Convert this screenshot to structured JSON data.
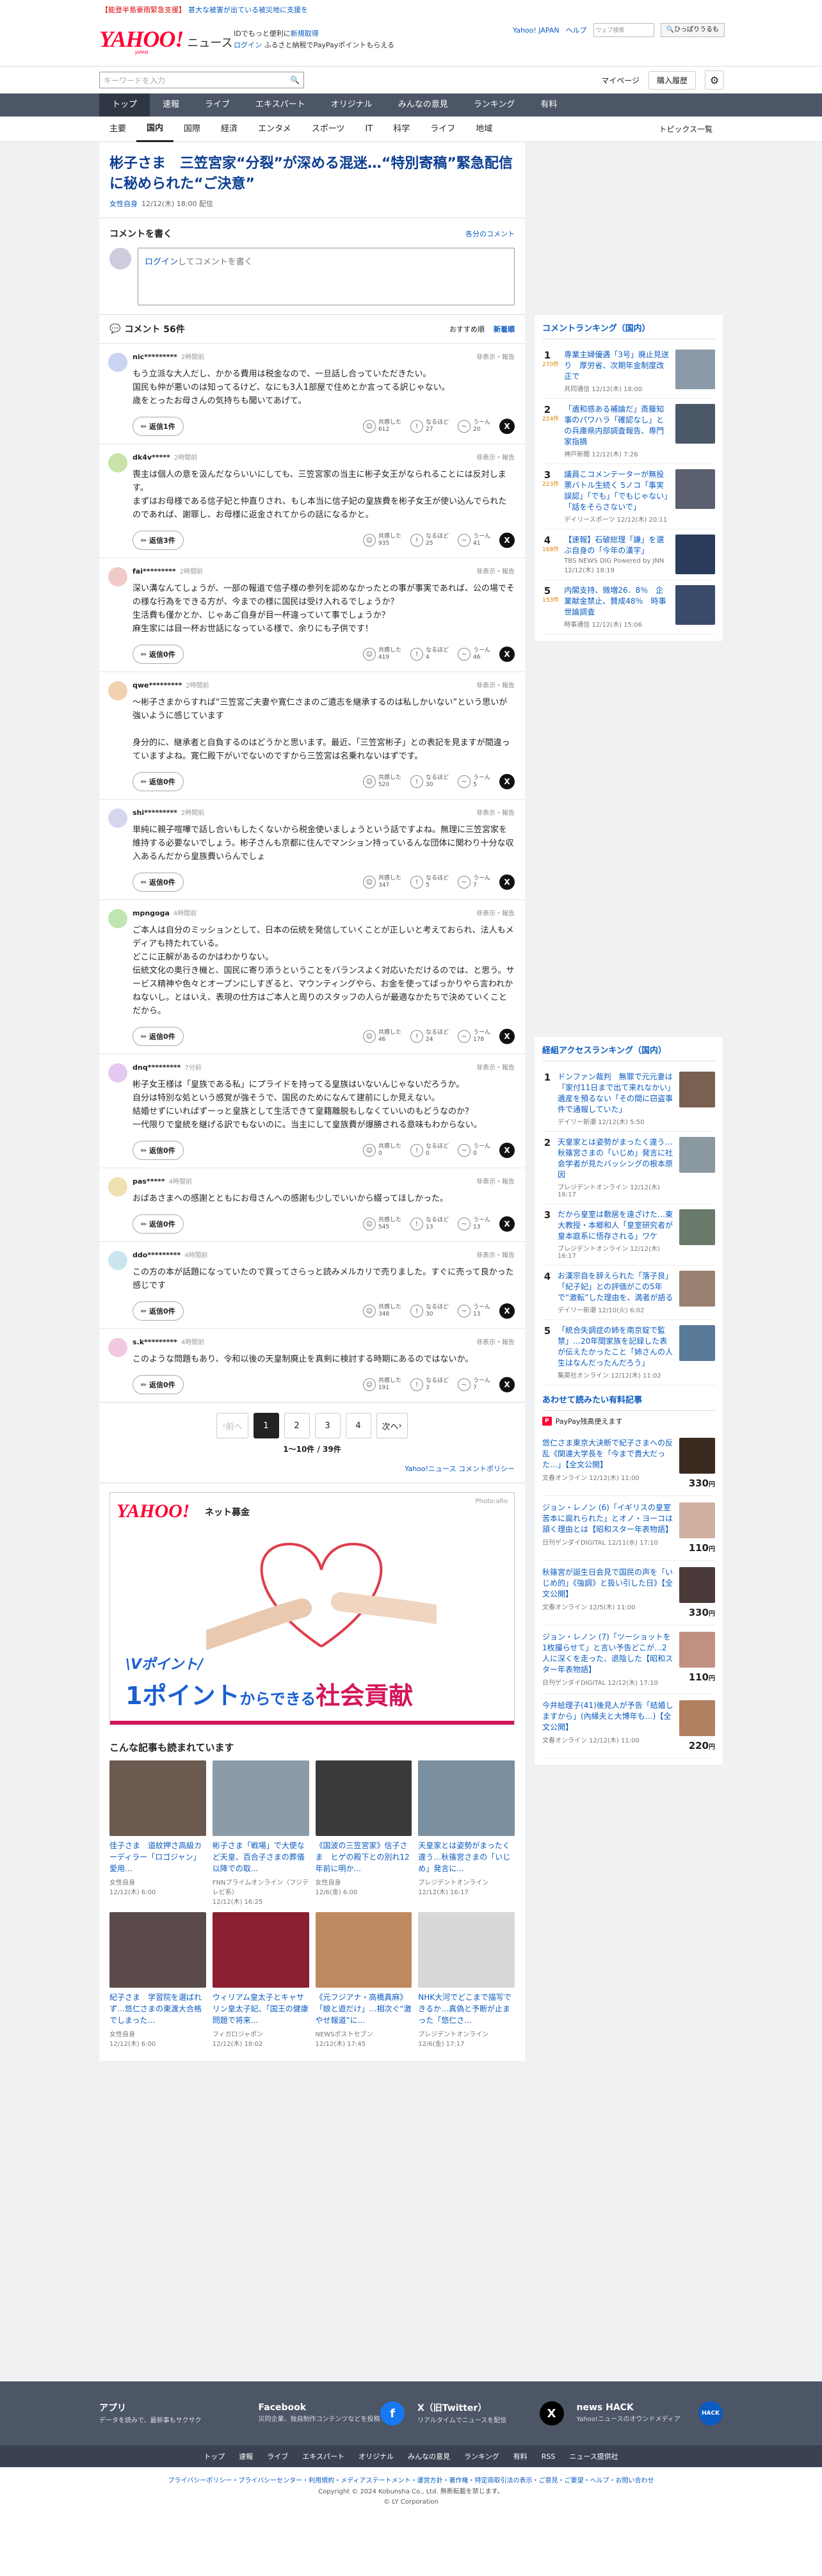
{
  "topad": {
    "tag": "【能登半島豪雨緊急支援】",
    "text": "甚大な被害が出ている被災地に支援を"
  },
  "header": {
    "logo": "YAHOO!",
    "logo_sub": "JAPAN",
    "service": "ニュース",
    "msg1": "IDでもっと便利に",
    "msg1_link": "新規取得",
    "msg2_link": "ログイン",
    "msg2_text": "ふるさと納税でPayPayポイントもらえる",
    "links": [
      "Yahoo! JAPAN",
      "ヘルプ"
    ],
    "site_search_placeholder": "ウェブ検索",
    "site_search_button": "🔍ひっぱりうるも"
  },
  "search": {
    "placeholder": "キーワードを入力",
    "my": "マイページ",
    "buy": "購入履歴"
  },
  "gnav": [
    "トップ",
    "速報",
    "ライブ",
    "エキスパート",
    "オリジナル",
    "みんなの意見",
    "ランキング",
    "有料"
  ],
  "snav": [
    "主要",
    "国内",
    "国際",
    "経済",
    "エンタメ",
    "スポーツ",
    "IT",
    "科学",
    "ライフ",
    "地域"
  ],
  "snav_right": "トピックス一覧",
  "article": {
    "title": "彬子さま　三笠宮家“分裂”が深める混迷…“特別寄稿”緊急配信に秘められた“ご決意”",
    "source": "女性自身",
    "date": "12/12(木) 18:00 配信"
  },
  "comment_form": {
    "title": "コメントを書く",
    "policy": "各分のコメント",
    "login": "ログイン",
    "placeholder": "してコメントを書く"
  },
  "comments_header": {
    "label": "コメント 56件",
    "sort1": "おすすめ順",
    "sort2": "新着順"
  },
  "comments": [
    {
      "user": "nic*********",
      "time": "2時間前",
      "report": "非表示・報告",
      "color": "#c9d4f0",
      "text": "もう立派な大人だし、かかる費用は税金なので、一旦話し合っていただきたい。\n国民も仲が悪いのは知ってるけど、なにも3人1部屋で住めとか言ってる訳じゃない。\n歳をとったお母さんの気持ちも聞いてあげて。",
      "reply": "返信1件",
      "k": "612",
      "n": "27",
      "u": "20"
    },
    {
      "user": "dk4v*****",
      "time": "2時間前",
      "report": "非表示・報告",
      "color": "#c9e3a8",
      "text": "喪主は個人の意を汲んだならいいにしても、三笠宮家の当主に彬子女王がなられることには反対します。\nまずはお母様である信子妃と仲直りされ、もし本当に信子妃の皇族費を彬子女王が使い込んでられたのであれば、謝罪し、お母様に返金されてからの話になるかと。",
      "reply": "返信3件",
      "k": "935",
      "n": "25",
      "u": "41"
    },
    {
      "user": "fai*********",
      "time": "2時間前",
      "report": "非表示・報告",
      "color": "#f0c9c9",
      "text": "深い溝なんてしょうが、一部の報道で信子様の参列を認めなかったとの事が事実であれば、公の場でその様な行為をできる方が、今までの様に国民は受け入れるでしょうか？\n生活費も僅かとか、じゃあご自身が目一杯違っていて事でしょうか？\n麻生家には目一杯お世話になっている様で、余りにも子供です！",
      "reply": "返信0件",
      "k": "419",
      "n": "4",
      "u": "46"
    },
    {
      "user": "qwe*********",
      "time": "2時間前",
      "report": "非表示・報告",
      "color": "#f0d2b0",
      "text": "〜彬子さまからすれば“三笠宮ご夫妻や寛仁さまのご遺志を継承するのは私しかいない”という思いが強いように感じています\n\n身分的に、継承者と自負するのはどうかと思います。最近、「三笠宮彬子」との表記を見ますが間違っていますよね。寛仁殿下がいでないのですから三笠宮は名乗れないはずです。",
      "reply": "返信0件",
      "k": "520",
      "n": "30",
      "u": "5"
    },
    {
      "user": "shi*********",
      "time": "2時間前",
      "report": "非表示・報告",
      "color": "#d6d6ee",
      "text": "単純に親子喧嘩で話し合いもしたくないから税金使いましょうという話ですよね。無理に三笠宮家を維持する必要ないでしょう。彬子さんも京都に住んでマンション持っているんな団体に関わり十分な収入あるんだから皇族費いらんでしょ",
      "reply": "返信0件",
      "k": "347",
      "n": "5",
      "u": "7"
    },
    {
      "user": "mpngoga",
      "time": "4時間前",
      "report": "非表示・報告",
      "color": "#bfe6b0",
      "text": "ご本人は自分のミッションとして、日本の伝統を発信していくことが正しいと考えておられ、法人もメディアも持たれている。\nどこに正解があるのかはわかりない。\n伝統文化の奥行き機と、国民に寄り添うということをバランスよく対応いただけるのでは、と思う。サービス精神や色々とオープンにしすぎると、マウンティングやら、お金を使ってばっかりやら言われかねないし。とはいえ、表現の仕方はご本人と周りのスタッフの人らが最適なかたちで決めていくことだから。",
      "reply": "返信0件",
      "k": "46",
      "n": "24",
      "u": "178"
    },
    {
      "user": "dnq*********",
      "time": "7分前",
      "report": "非表示・報告",
      "color": "#e6c9f0",
      "text": "彬子女王様は「皇族である私」にプライドを持ってる皇族はいないんじゃないだろうか。\n自分は特別な処という感覚が強そうで、国民のためになんて建前にしか見えない。\n結婚せずにいればずーっと皇族として生活できて皇籍離脱もしなくていいのもどうなのか？\n一代限りで皇統を継げる訳でもないのに。当主にして皇族費が爆勝される意味もわからない。",
      "reply": "返信0件",
      "k": "0",
      "n": "0",
      "u": "0"
    },
    {
      "user": "pas*****",
      "time": "4時間前",
      "report": "非表示・報告",
      "color": "#f0e0b0",
      "text": "おばあさまへの感謝とともにお母さんへの感謝も少しでいいから綴ってほしかった。",
      "reply": "返信0件",
      "k": "545",
      "n": "13",
      "u": "13"
    },
    {
      "user": "ddo*********",
      "time": "4時間前",
      "report": "非表示・報告",
      "color": "#c9e6f0",
      "text": "この方の本が話題になっていたので買ってさらっと読みメルカリで売りました。すぐに売って良かった感じです",
      "reply": "返信0件",
      "k": "348",
      "n": "30",
      "u": "13"
    },
    {
      "user": "s.k*********",
      "time": "4時間前",
      "report": "非表示・報告",
      "color": "#f0c9e0",
      "text": "このような問題もあり、令和以後の天皇制廃止を真剣に検討する時期にあるのではないか。",
      "reply": "返信0件",
      "k": "191",
      "n": "3",
      "u": "7"
    }
  ],
  "reaction_labels": {
    "k": "共感した",
    "n": "なるほど",
    "u": "うーん"
  },
  "pager": {
    "prev": "前へ",
    "pages": [
      "1",
      "2",
      "3",
      "4"
    ],
    "next": "次へ",
    "info": "1〜10件 / 39件",
    "policy": "Yahoo!ニュース コメントポリシー"
  },
  "ad": {
    "logo": "YAHOO!",
    "title": "ネット募金",
    "photo": "Photo:afio",
    "v": "\\Vポイント/",
    "big1": "1ポイント",
    "big2": "からできる",
    "big3": "社会貢献"
  },
  "related": {
    "title": "こんな記事も読まれています",
    "items": [
      {
        "t": "佳子さま　道紋押さ高級カーディラー「ロゴジャン」愛用...",
        "s": "女性自身\n12/12(木) 6:00",
        "c": "#6b5a50"
      },
      {
        "t": "彬子さま「戦場」で大使など天皇、百合子さまの葬儀以降での取...",
        "s": "FNNプライムオンライン（フジテレビ系）\n12/12(木) 16:25",
        "c": "#8c9ba8"
      },
      {
        "t": "《国波の三笠宮家》信子さま　ヒゲの殿下との別れ12年前に明か...",
        "s": "女性自身\n12/6(金) 6:00",
        "c": "#3a3a3a"
      },
      {
        "t": "天皇家とは姿勢がまったく違う…秋篠宮さまの「いじめ」発言に...",
        "s": "プレジデントオンライン\n12/12(木) 16:17",
        "c": "#7a8fa0"
      },
      {
        "t": "紀子さま　学習院を選ばれず…悠仁さまの東渡大合格でしまった...",
        "s": "女性自身\n12/12(木) 6:00",
        "c": "#5a4a4a"
      },
      {
        "t": "ウィリアム皇太子とキャサリン皇太子妃、「国王の健康問題で将来...",
        "s": "フィガロジャポン\n12/12(木) 18:02",
        "c": "#8a2030"
      },
      {
        "t": "《元フジアナ・高橋真麻》「娘と遊だけ」…相次ぐ“激やせ報道”に...",
        "s": "NEWSポストセブン\n12/12(木) 17:45",
        "c": "#c08a60"
      },
      {
        "t": "NHK大河でどこまで描写できるか…真偽と予断が止まった「悠仁さ...",
        "s": "プレジデントオンライン\n12/6(金) 17:17",
        "c": "#d8d8d8"
      }
    ]
  },
  "ranking": {
    "title": "コメントランキング（国内）",
    "items": [
      {
        "n": "1",
        "c": "270件",
        "t": "専業主婦優遇「3号」廃止見送り　厚労省、次期年金制度改正で",
        "s": "共同通信 12/12(木) 18:00",
        "col": "#8a9aa8"
      },
      {
        "n": "2",
        "c": "224件",
        "t": "「遺和感ある補論だ」斎藤知事のパワハラ「確認なし」との兵庫県内部調査報告、専門家指摘",
        "s": "神戸新聞 12/12(木) 7:26",
        "col": "#4a5868"
      },
      {
        "n": "3",
        "c": "223件",
        "t": "議員こコメンテーターが無投票バトル生続く 5ノコ「事実誤認」「でも」「でもじゃない」「話をそらさないで」",
        "s": "デイリースポーツ 12/12(木) 20:11",
        "col": "#5a6070"
      },
      {
        "n": "4",
        "c": "168件",
        "t": "【速報】石破総理「謙」を選ぶ自身の「今年の漢字」",
        "s": "TBS NEWS DIG Powered by JNN 12/12(木) 18:19",
        "col": "#2a3a5a"
      },
      {
        "n": "5",
        "c": "153件",
        "t": "内閣支持、微増26．8％　企業献金禁止、賛成48％　時事世論調査",
        "s": "時事通信 12/12(木) 15:06",
        "col": "#3a4a6a"
      }
    ]
  },
  "access_ranking": {
    "title": "経組アクセスランキング（国内）",
    "items": [
      {
        "n": "1",
        "t": "ドンファン裁判　無罪で元元妻は「家付11日まで出て来れなかい」遺産を預るない「その間に窃盗事件で通報していた」",
        "s": "デイリー新潮 12/12(木) 5:50",
        "col": "#7a6050"
      },
      {
        "n": "2",
        "t": "天皇家とは姿勢がまったく違う…秋篠宮さまの「いじめ」発言に社会学者が見たバッシングの根本原因",
        "s": "プレジデントオンライン 12/12(木) 16:17",
        "col": "#8a98a0"
      },
      {
        "n": "3",
        "t": "だから皇室は敷居を遠ざけた…東大教授・本郷和人「皇室研究者が皇本庭系に悟存される」ワケ",
        "s": "プレジデントオンライン 12/12(木) 16:17",
        "col": "#6a7a6a"
      },
      {
        "n": "4",
        "t": "お漢宗自を辞えられた「落子良」「紀子妃」との評価がこの5年で“激転”した理由を、満者が語る",
        "s": "デイリー新潮 12/10(火) 6:02",
        "col": "#9a8070"
      },
      {
        "n": "5",
        "t": "「統合失調症の姉を南京錠で監禁」…20年間家族を記録した表が伝えたかったこと「姉さんの人生はなんだったんだろう」",
        "s": "集英社オンライン 12/12(木) 11:02",
        "col": "#5a7a9a"
      }
    ]
  },
  "paid": {
    "title": "あわせて読みたい有料記事",
    "paypay": "PayPay残高使えます",
    "items": [
      {
        "t": "悠仁さま東京大決断で紀子さまへの反乱《関達大学長を「今まで貴大だった…」【全文公開】",
        "s": "文春オンライン 12/12(木) 11:00",
        "p": "330",
        "col": "#3a2a20"
      },
      {
        "t": "ジョン・レノン (6)「イギリスの皇室苦本に腐れられた」とオノ・ヨーコは頷く理由とは【昭和スター年表物語】",
        "s": "日刊ゲンダイDIGITAL 12/11(水) 17:10",
        "p": "110",
        "col": "#d0b0a0"
      },
      {
        "t": "秋篠宮が誕生日会見で国民の声を「いじめ的」《強調》と扱い引した日》【全文公開】",
        "s": "文春オンライン 12/5(木) 11:00",
        "p": "330",
        "col": "#4a3a3a"
      },
      {
        "t": "ジョン・レノン (7)「ツーショットを1枚撮らせて」と言い予告どこが…2人に深くを走った、退陰した【昭和スター年表物語】",
        "s": "日刊ゲンダイDIGITAL 12/12(木) 17:10",
        "p": "110",
        "col": "#c09080"
      },
      {
        "t": "今井絵理子(41)後見人が予告「結婚しますから」(內縁夫と大博年も…)【全文公開】",
        "s": "文春オンライン 12/12(木) 11:00",
        "p": "220",
        "col": "#b08060"
      }
    ]
  },
  "footer": {
    "apps": [
      {
        "n": "アプリ",
        "d": "データを読みで、最新事もサクサク",
        "ic": "",
        "col": "#4c5666"
      },
      {
        "n": "Facebook",
        "d": "災同企業、独自制作コンテンツなどを投稿",
        "ic": "f",
        "col": "#1877f2"
      },
      {
        "n": "X（旧Twitter）",
        "d": "リアルタイムでニュースを配信",
        "ic": "X",
        "col": "#000"
      },
      {
        "n": "news HACK",
        "d": "Yahoo!ニュースのオウンドメディア",
        "ic": "HACK",
        "col": "#0b5bc2"
      }
    ],
    "nav": [
      "トップ",
      "速報",
      "ライブ",
      "エキスパート",
      "オリジナル",
      "みんなの意見",
      "ランキング",
      "有料",
      "RSS",
      "ニュース提供社"
    ],
    "links": "プライバシーポリシー・プライバシーセンター・利用規約・メディアステートメント・運営方針・著作権・特定商取引法の表示・ご意見・ご要望・ヘルプ・お問い合わせ",
    "copy1": "Copyright © 2024 Kobunsha Co., Ltd. 無断転載を禁じます。",
    "copy2": "© LY Corporation"
  }
}
